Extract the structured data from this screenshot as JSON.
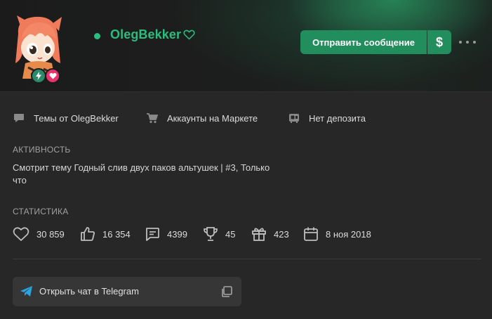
{
  "profile": {
    "username": "OlegBekker",
    "online": true,
    "send_message_label": "Отправить сообщение",
    "money_label": "$"
  },
  "links": [
    {
      "label": "Темы от OlegBekker",
      "icon": "chat-bubble-icon"
    },
    {
      "label": "Аккаунты на Маркете",
      "icon": "cart-icon"
    },
    {
      "label": "Нет депозита",
      "icon": "deposit-icon"
    }
  ],
  "activity": {
    "title": "АКТИВНОСТЬ",
    "line1": "Смотрит тему Годный слив двух паков альтушек | #3, Только",
    "line2": "что"
  },
  "stats": {
    "title": "СТАТИСТИКА",
    "items": [
      {
        "icon": "heart-icon",
        "value": "30 859"
      },
      {
        "icon": "thumbs-up-icon",
        "value": "16 354"
      },
      {
        "icon": "message-icon",
        "value": "4399"
      },
      {
        "icon": "trophy-icon",
        "value": "45"
      },
      {
        "icon": "gift-icon",
        "value": "423"
      },
      {
        "icon": "calendar-icon",
        "value": "8 ноя 2018"
      }
    ]
  },
  "telegram": {
    "label": "Открыть чат в Telegram"
  },
  "colors": {
    "accent": "#2bbd7e",
    "button": "#228e5d",
    "background": "#272727",
    "header": "#1b1b1b"
  }
}
